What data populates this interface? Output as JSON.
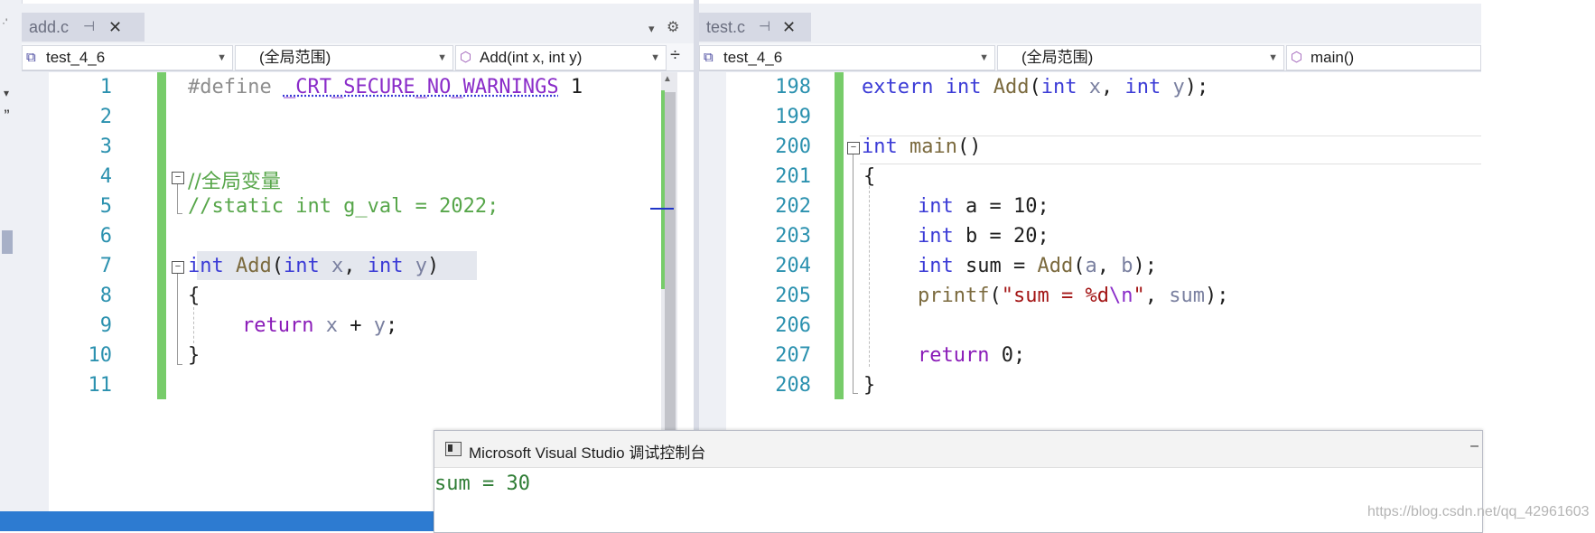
{
  "left_strip": {
    "glyph_top": "·'",
    "glyph_a": "▾",
    "glyph_b": "”"
  },
  "left_pane": {
    "tab": {
      "label": "add.c",
      "pin": "⊣",
      "close": "✕"
    },
    "tab_menu": "▾",
    "tab_gear": "⚙",
    "nav": {
      "project": "test_4_6",
      "scope": "(全局范围)",
      "member": "Add(int x, int y)",
      "split": "÷"
    },
    "line_numbers": [
      "1",
      "2",
      "3",
      "4",
      "5",
      "6",
      "7",
      "8",
      "9",
      "10",
      "11"
    ],
    "lines": {
      "l1_define": "#define ",
      "l1_macro": "_CRT_SECURE_NO_WARNINGS",
      "l1_value": " 1",
      "l4": "//全局变量",
      "l5": "//static int g_val = 2022;",
      "l7_int": "int",
      "l7_add": " Add",
      "l7_open": "(",
      "l7_int2": "int",
      "l7_x": " x",
      "l7_comma": ", ",
      "l7_int3": "int",
      "l7_y": " y",
      "l7_close": ")",
      "l8": "{",
      "l9_return": "return",
      "l9_x": " x",
      "l9_plus": " + ",
      "l9_y": "y",
      "l9_semi": ";",
      "l10": "}"
    },
    "fold_sign": "−"
  },
  "right_pane": {
    "tab": {
      "label": "test.c",
      "pin": "⊣",
      "close": "✕"
    },
    "nav": {
      "project": "test_4_6",
      "scope": "(全局范围)",
      "member": "main()"
    },
    "line_numbers": [
      "198",
      "199",
      "200",
      "201",
      "202",
      "203",
      "204",
      "205",
      "206",
      "207",
      "208"
    ],
    "lines": {
      "l198_extern": "extern",
      "l198_int": " int",
      "l198_add": " Add",
      "l198_open": "(",
      "l198_int2": "int",
      "l198_x": " x",
      "l198_comma": ", ",
      "l198_int3": "int",
      "l198_y": " y",
      "l198_close": ");",
      "l200_int": "int",
      "l200_main": " main",
      "l200_paren": "()",
      "l201": "{",
      "l202_int": "int",
      "l202_rest": " a = 10;",
      "l203_int": "int",
      "l203_rest": " b = 20;",
      "l204_int": "int",
      "l204_sum": " sum = ",
      "l204_add": "Add",
      "l204_open": "(",
      "l204_a": "a",
      "l204_comma": ", ",
      "l204_b": "b",
      "l204_close": ");",
      "l205_printf": "printf",
      "l205_open": "(",
      "l205_str1": "\"sum = %d",
      "l205_esc": "\\n",
      "l205_str2": "\"",
      "l205_comma": ", ",
      "l205_sum": "sum",
      "l205_close": ");",
      "l207_return": "return",
      "l207_rest": " 0;",
      "l208": "}"
    },
    "fold_sign": "−"
  },
  "console": {
    "title": "Microsoft Visual Studio 调试控制台",
    "minimize": "–",
    "output": "sum = 30"
  },
  "watermark": "https://blog.csdn.net/qq_42961603"
}
